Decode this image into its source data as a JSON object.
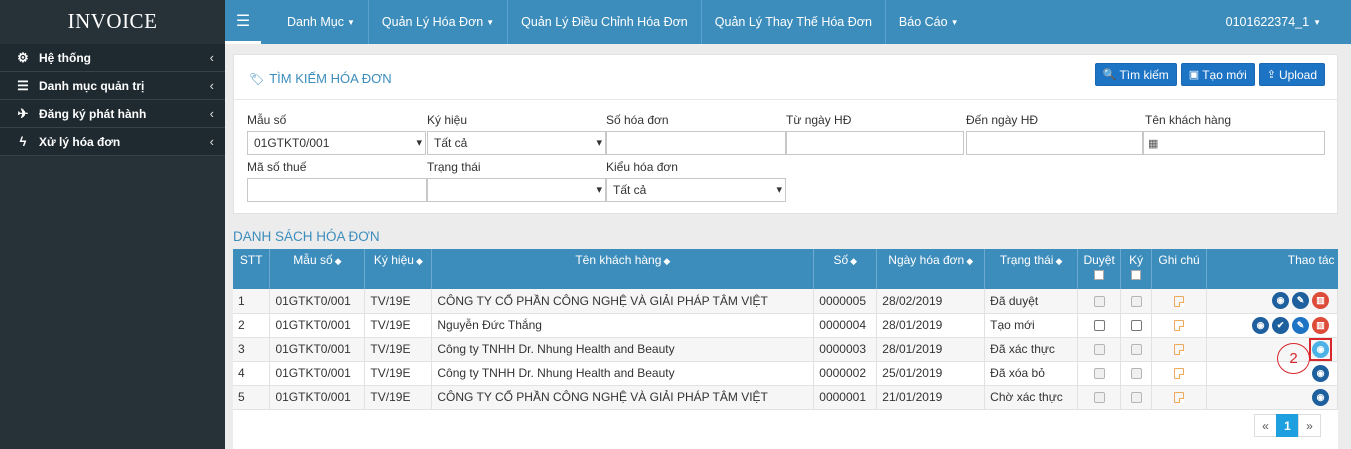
{
  "sidebar": {
    "brand": "INVOICE",
    "items": [
      {
        "label": "Hệ thống",
        "icon": "gear-icon"
      },
      {
        "label": "Danh mục quản trị",
        "icon": "list-icon"
      },
      {
        "label": "Đăng ký phát hành",
        "icon": "plane-icon"
      },
      {
        "label": "Xử lý hóa đơn",
        "icon": "bolt-icon"
      }
    ]
  },
  "topbar": {
    "nav": [
      {
        "label": "Danh Mục",
        "dropdown": true
      },
      {
        "label": "Quản Lý Hóa Đơn",
        "dropdown": true
      },
      {
        "label": "Quản Lý Điều Chỉnh Hóa Đơn",
        "dropdown": false
      },
      {
        "label": "Quản Lý Thay Thế Hóa Đơn",
        "dropdown": false
      },
      {
        "label": "Báo Cáo",
        "dropdown": true
      }
    ],
    "user": "0101622374_1"
  },
  "search": {
    "title": "TÌM KIẾM HÓA ĐƠN",
    "buttons": {
      "search": "Tìm kiếm",
      "create": "Tạo mới",
      "upload": "Upload"
    },
    "fields": {
      "mau_so": {
        "label": "Mẫu số",
        "value": "01GTKT0/001"
      },
      "ky_hieu": {
        "label": "Ký hiệu",
        "value": "Tất cả"
      },
      "so_hoa_don": {
        "label": "Số hóa đơn",
        "value": ""
      },
      "tu_ngay": {
        "label": "Từ ngày HĐ",
        "value": ""
      },
      "den_ngay": {
        "label": "Đến ngày HĐ",
        "value": ""
      },
      "ten_khach_hang": {
        "label": "Tên khách hàng",
        "value": ""
      },
      "ma_so_thue": {
        "label": "Mã số thuế",
        "value": ""
      },
      "trang_thai": {
        "label": "Trạng thái",
        "value": ""
      },
      "kieu_hoa_don": {
        "label": "Kiểu hóa đơn",
        "value": "Tất cả"
      }
    }
  },
  "list": {
    "title": "DANH SÁCH HÓA ĐƠN",
    "headers": {
      "stt": "STT",
      "mau_so": "Mẫu số",
      "ky_hieu": "Ký hiệu",
      "ten_kh": "Tên khách hàng",
      "so": "Số",
      "ngay": "Ngày hóa đơn",
      "trang_thai": "Trạng thái",
      "duyet": "Duyệt",
      "ky": "Ký",
      "ghi_chu": "Ghi chú",
      "thao_tac": "Thao tác"
    },
    "rows": [
      {
        "stt": "1",
        "mau_so": "01GTKT0/001",
        "ky_hieu": "TV/19E",
        "ten_kh": "CÔNG TY CỔ PHẦN CÔNG NGHỆ VÀ GIẢI PHÁP TÂM VIỆT",
        "so": "0000005",
        "ngay": "28/02/2019",
        "trang_thai": "Đã duyệt"
      },
      {
        "stt": "2",
        "mau_so": "01GTKT0/001",
        "ky_hieu": "TV/19E",
        "ten_kh": "Nguyễn Đức Thắng",
        "so": "0000004",
        "ngay": "28/01/2019",
        "trang_thai": "Tạo mới"
      },
      {
        "stt": "3",
        "mau_so": "01GTKT0/001",
        "ky_hieu": "TV/19E",
        "ten_kh": "Công ty TNHH Dr. Nhung Health and Beauty",
        "so": "0000003",
        "ngay": "28/01/2019",
        "trang_thai": "Đã xác thực"
      },
      {
        "stt": "4",
        "mau_so": "01GTKT0/001",
        "ky_hieu": "TV/19E",
        "ten_kh": "Công ty TNHH Dr. Nhung Health and Beauty",
        "so": "0000002",
        "ngay": "25/01/2019",
        "trang_thai": "Đã xóa bỏ"
      },
      {
        "stt": "5",
        "mau_so": "01GTKT0/001",
        "ky_hieu": "TV/19E",
        "ten_kh": "CÔNG TY CỔ PHẦN CÔNG NGHỆ VÀ GIẢI PHÁP TÂM VIỆT",
        "so": "0000001",
        "ngay": "21/01/2019",
        "trang_thai": "Chờ xác thực"
      }
    ]
  },
  "annotation": {
    "step": "2"
  },
  "pagination": {
    "prev": "«",
    "current": "1",
    "next": "»"
  }
}
